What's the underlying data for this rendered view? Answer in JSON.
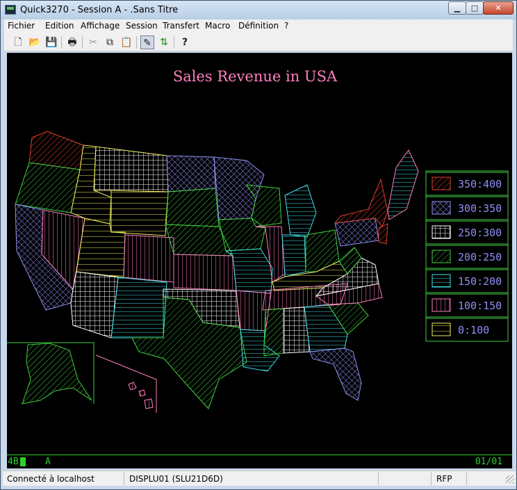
{
  "window": {
    "title": "Quick3270 - Session A - .Sans Titre"
  },
  "menu": [
    "Fichier",
    "Edition",
    "Affichage",
    "Session",
    "Transfert",
    "Macro",
    "Définition",
    "?"
  ],
  "toolbar": {
    "icons": [
      "new-document-icon",
      "open-folder-icon",
      "save-disk-icon",
      "print-icon",
      "cut-icon",
      "copy-icon",
      "paste-icon",
      "edit-toggle-icon",
      "transfer-arrows-icon",
      "help-icon"
    ]
  },
  "chart": {
    "title": "Sales Revenue in USA",
    "legend": [
      {
        "label": "350:400",
        "color": "#e0402c",
        "pattern": "diag"
      },
      {
        "label": "300:350",
        "color": "#8f8ff5",
        "pattern": "cross"
      },
      {
        "label": "250:300",
        "color": "#ffffff",
        "pattern": "grid"
      },
      {
        "label": "200:250",
        "color": "#3ed13e",
        "pattern": "diag"
      },
      {
        "label": "150:200",
        "color": "#40e0e8",
        "pattern": "hlines"
      },
      {
        "label": "100:150",
        "color": "#ff80c0",
        "pattern": "vlines"
      },
      {
        "label": "0:100",
        "color": "#f0f060",
        "pattern": "hlines"
      }
    ]
  },
  "oia": {
    "left": "4B",
    "session": "A",
    "page": "01/01"
  },
  "status": {
    "connection": "Connecté à localhost",
    "device": "DISPLU01 (SLU21D6D)",
    "mode": "RFP"
  }
}
